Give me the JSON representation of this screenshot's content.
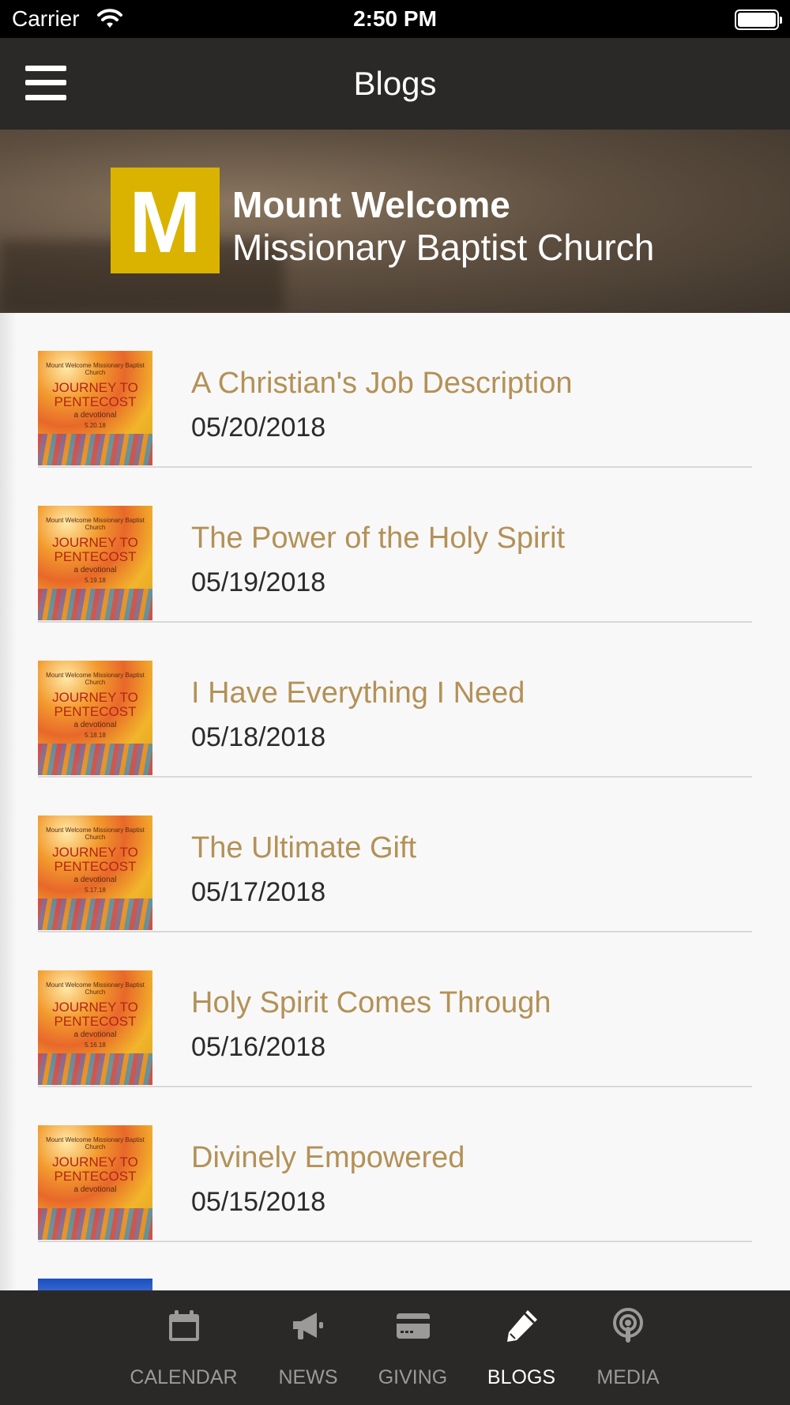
{
  "status_bar": {
    "carrier": "Carrier",
    "time": "2:50 PM"
  },
  "nav": {
    "title": "Blogs"
  },
  "banner": {
    "logo_letter": "M",
    "line1": "Mount Welcome",
    "line2": "Missionary Baptist Church"
  },
  "thumbnail": {
    "header": "Mount Welcome Missionary Baptist Church",
    "journey": "JOURNEY TO",
    "pentecost": "PENTECOST",
    "devotional": "a devotional"
  },
  "posts": [
    {
      "title": "A Christian's Job Description",
      "date": "05/20/2018",
      "thumb_date": "5.20.18"
    },
    {
      "title": "The Power of the Holy Spirit",
      "date": "05/19/2018",
      "thumb_date": "5.19.18"
    },
    {
      "title": "I Have Everything I Need",
      "date": "05/18/2018",
      "thumb_date": "5.18.18"
    },
    {
      "title": "The Ultimate Gift",
      "date": "05/17/2018",
      "thumb_date": "5.17.18"
    },
    {
      "title": "Holy Spirit Comes Through",
      "date": "05/16/2018",
      "thumb_date": "5.16.18"
    },
    {
      "title": "Divinely Empowered",
      "date": "05/15/2018",
      "thumb_date": ""
    }
  ],
  "tabs": [
    {
      "label": "CALENDAR",
      "icon": "calendar-icon"
    },
    {
      "label": "NEWS",
      "icon": "megaphone-icon"
    },
    {
      "label": "GIVING",
      "icon": "credit-card-icon"
    },
    {
      "label": "BLOGS",
      "icon": "pencil-icon",
      "active": true
    },
    {
      "label": "MEDIA",
      "icon": "podcast-icon"
    }
  ],
  "colors": {
    "accent_gold": "#b39157",
    "logo_yellow": "#d9b300",
    "bar_dark": "#2b2927"
  }
}
